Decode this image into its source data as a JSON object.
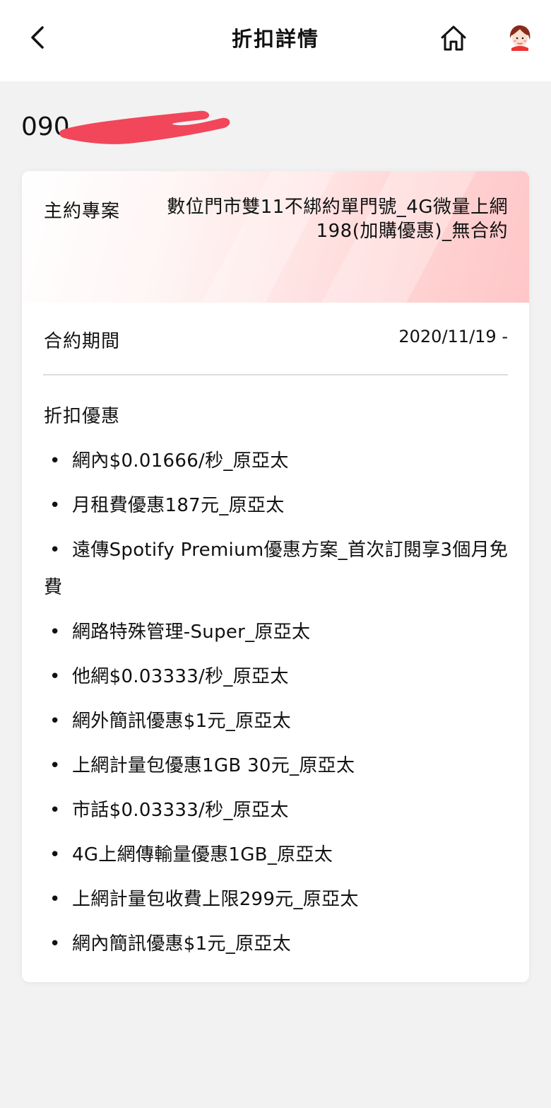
{
  "header": {
    "title": "折扣詳情",
    "back_icon": "chevron-left-icon",
    "home_icon": "home-icon",
    "avatar_icon": "user-avatar-icon"
  },
  "account": {
    "phone_prefix": "090"
  },
  "plan": {
    "label": "主約專案",
    "name": "數位門市雙11不綁約單門號_4G微量上網198(加購優惠)_無合約"
  },
  "contract": {
    "label": "合約期間",
    "period": "2020/11/19 -"
  },
  "discounts": {
    "title": "折扣優惠",
    "bullet": "•",
    "items": [
      "網內$0.01666/秒_原亞太",
      "月租費優惠187元_原亞太",
      "遠傳Spotify Premium優惠方案_首次訂閱享3個月免費",
      "網路特殊管理-Super_原亞太",
      "他網$0.03333/秒_原亞太",
      "網外簡訊優惠$1元_原亞太",
      "上網計量包優惠1GB 30元_原亞太",
      "市話$0.03333/秒_原亞太",
      "4G上網傳輸量優惠1GB_原亞太",
      "上網計量包收費上限299元_原亞太",
      "網內簡訊優惠$1元_原亞太"
    ]
  },
  "colors": {
    "background": "#f2f2f2",
    "card": "#ffffff",
    "accent_pink": "#ffc6c8",
    "redaction": "#f2465a"
  }
}
